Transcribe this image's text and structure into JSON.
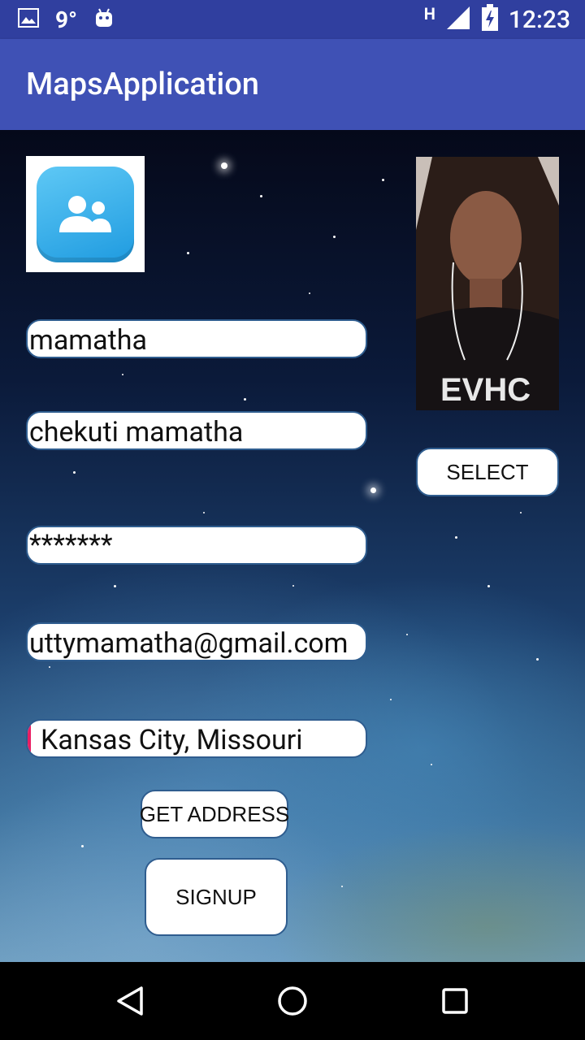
{
  "status_bar": {
    "temperature": "9°",
    "network_label": "H",
    "time": "12:23",
    "icons": [
      "image-icon",
      "android-icon",
      "signal-icon",
      "battery-charging-icon"
    ]
  },
  "app_bar": {
    "title": "MapsApplication"
  },
  "form": {
    "first_name": "mamatha",
    "full_name": "chekuti mamatha",
    "password": "*******",
    "email": "uttymamatha@gmail.com",
    "address": "Kansas City, Missouri"
  },
  "buttons": {
    "select": "SELECT",
    "get_address": "GET ADDRESS",
    "signup": "SIGNUP"
  },
  "icons": {
    "logo": "contacts-icon",
    "nav_back": "back-triangle-icon",
    "nav_home": "home-circle-icon",
    "nav_recents": "recents-square-icon"
  },
  "colors": {
    "status_bar": "#303f9f",
    "app_bar": "#3f51b5",
    "field_border": "#2f5d8f",
    "cursor": "#e91e63"
  }
}
